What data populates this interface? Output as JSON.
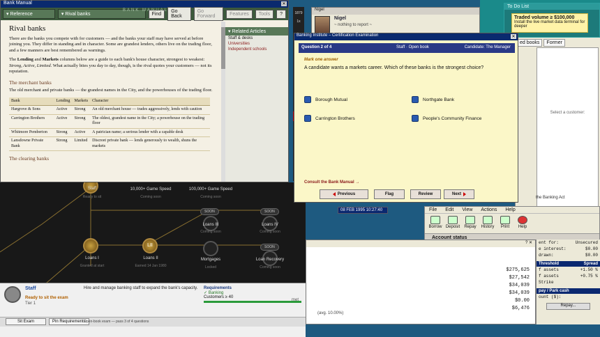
{
  "todo": {
    "header": "To Do List",
    "card_title": "Traded volume ≥ $100,000",
    "card_text": "Install the live market data terminal for deeper"
  },
  "crm": {
    "tabs": [
      "ed books",
      "Former"
    ],
    "placeholder": "Select a customer:"
  },
  "nigel": {
    "title": "Nigel",
    "name": "Nigel",
    "status": "~ nothing to report ~"
  },
  "strip": {
    "values": [
      "1879",
      "1x"
    ]
  },
  "datebar": "08 FEB 1995 10:27:40",
  "banking_act": "the Banking Act",
  "accounts_window": {
    "menu": [
      "File",
      "Edit",
      "View",
      "Actions",
      "Help"
    ],
    "tools": [
      "Borrow",
      "Deposit",
      "Repay",
      "History",
      "Print",
      "Help"
    ],
    "status": "Account status"
  },
  "ledger": {
    "values": [
      "$275,625",
      "$27,542",
      "$34,039",
      "$34,039",
      "$0.00",
      "$6,476"
    ],
    "note": "(avg. 10.00%)"
  },
  "rates": {
    "rows": [
      {
        "k": "ent for:",
        "v": "Unsecured"
      },
      {
        "k": "e interest:",
        "v": "$0.00"
      },
      {
        "k": "drawn:",
        "v": "$0.00"
      }
    ],
    "header": {
      "k": "Threshold",
      "v": "Spread"
    },
    "spread_rows": [
      {
        "k": "f assets",
        "v": "+1.50 %"
      },
      {
        "k": "f assets",
        "v": "+0.75 %"
      }
    ],
    "label_strike": "Strike",
    "pay_label": "pay / Park cash",
    "amount_label": "ount ($):",
    "repay_button": "Repay..."
  },
  "manual": {
    "window_title": "Bank Manual",
    "bar_title": "BANK MANUAL",
    "reference_dropdown": "Reference",
    "section_dropdown": "Rival banks",
    "find_button": "Find",
    "goback_button": "Go Back",
    "goforward_button": "Go Forward",
    "features_button": "Features",
    "tools_button": "Tools",
    "help_button": "?",
    "heading": "Rival banks",
    "intro": "There are the banks you compete with for customers — and the banks your staff may have served at before joining you. They differ in standing and in character. Some are grandest lenders, others live on the trading floor, and a few manners are best remembered as warnings.",
    "para2_a": "The ",
    "para2_lending": "Lending",
    "para2_b": " and ",
    "para2_markets": "Markets",
    "para2_c": " columns below are a guide to each bank's house character, strongest to weakest: ",
    "para2_scale": "Strong, Active, Limited.",
    "para2_d": " What actually bites you day to day, though, is the rival quotes your customers — not its reputation.",
    "merchant_heading": "The merchant banks",
    "merchant_text": "The old merchant and private banks — the grandest names in the City, and the powerhouses of the trading floor.",
    "table_headers": [
      "Bank",
      "Lending",
      "Markets",
      "Character"
    ],
    "table_rows": [
      [
        "Hargrove & Sons",
        "Active",
        "Strong",
        "An old merchant house — trades aggressively, lends with caution"
      ],
      [
        "Carrington Brothers",
        "Active",
        "Strong",
        "The oldest, grandest name in the City; a powerhouse on the trading floor"
      ],
      [
        "Whitmore Pemberton",
        "Strong",
        "Active",
        "A patrician name; a serious lender with a capable desk"
      ],
      [
        "Lansdowne Private Bank",
        "Strong",
        "Limited",
        "Discreet private bank — lends generously to wealth, shuns the markets"
      ]
    ],
    "clearing_heading": "The clearing banks",
    "related_header": "Related Articles",
    "related_links": [
      "Staff & desks",
      "Universities",
      "Independent schools"
    ]
  },
  "tree": {
    "nodes": [
      {
        "label": "Staff",
        "sub": "Ready to sit"
      },
      {
        "label": "10,000+ Game Speed",
        "sub": "Coming soon"
      },
      {
        "label": "100,000+ Game Speed",
        "sub": "Coming soon"
      },
      {
        "label": "Loans III",
        "sub": "Coming soon"
      },
      {
        "label": "Loans IV",
        "sub": "Coming soon"
      },
      {
        "label": "Loans I",
        "sub": "Granted at start"
      },
      {
        "label": "Loans II",
        "sub": "Earned 14 Jan 1980"
      },
      {
        "label": "Mortgages",
        "sub": "Locked"
      },
      {
        "label": "Loan Recovery",
        "sub": "Coming soon"
      }
    ],
    "soon": "SOON",
    "roman": "LII"
  },
  "staff": {
    "name": "Staff",
    "ready": "Ready to sit the exam",
    "tier": "Tier 1",
    "description": "Hire and manage banking staff to expand the bank's capacity.",
    "req_title": "Requirements",
    "req_items": [
      "✓ Banking",
      "Customers ≥ 40"
    ],
    "req_met": "met",
    "sit_button": "Sit Exam",
    "pin_button": "Pin Requirements",
    "blurb": "Open-book exam — pass 3 of 4 questions"
  },
  "exam": {
    "window_title": "Banking Institute – Certification Examination",
    "question": "Question 2 of 4",
    "mode_a": "Staff",
    "mode_b": "Open book",
    "candidate": "Candidate: The Manager",
    "mark": "Mark one answer",
    "prompt": "A candidate wants a markets career. Which of these banks is the strongest choice?",
    "options": [
      "Borough Mutual",
      "Northgate Bank",
      "Carrington Brothers",
      "People's Community Finance"
    ],
    "consult": "Consult the Bank Manual →",
    "previous": "Previous",
    "flag": "Flag",
    "review": "Review",
    "next": "Next"
  }
}
